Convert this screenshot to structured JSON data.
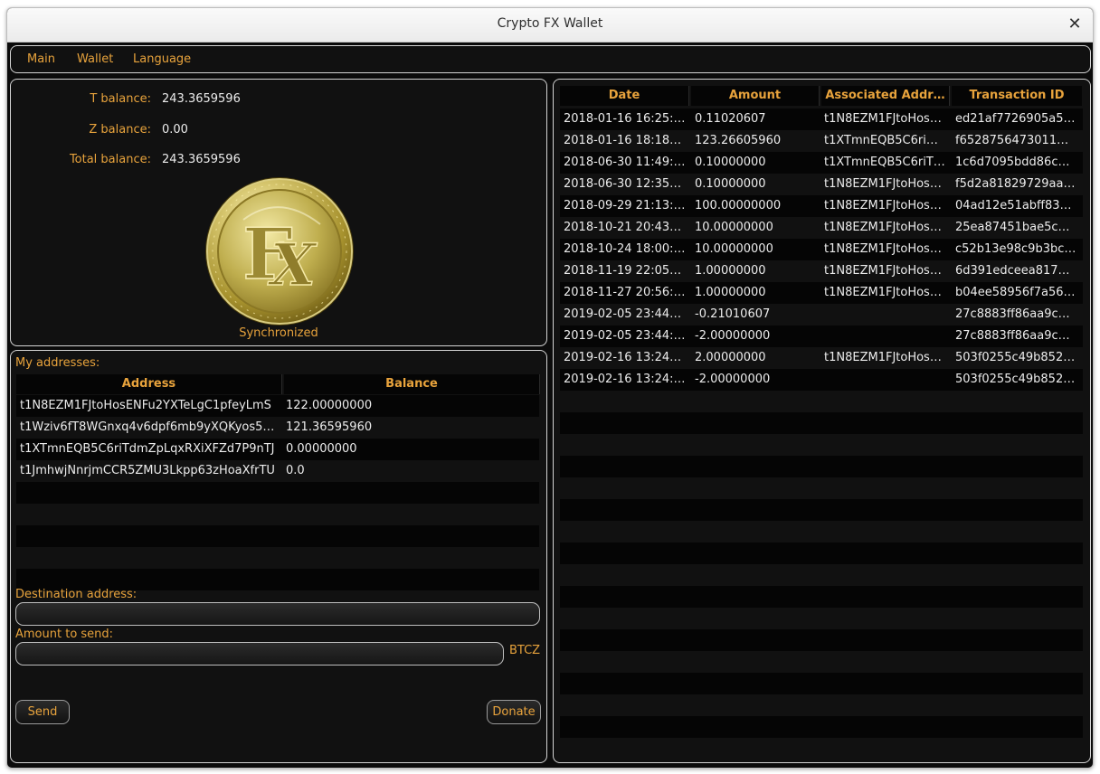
{
  "window": {
    "title": "Crypto FX Wallet"
  },
  "menu": {
    "items": [
      "Main",
      "Wallet",
      "Language"
    ]
  },
  "balances": {
    "t_label": "T balance:",
    "t_value": "243.3659596",
    "z_label": "Z balance:",
    "z_value": "0.00",
    "total_label": "Total balance:",
    "total_value": "243.3659596",
    "status": "Synchronized"
  },
  "addresses": {
    "title": "My addresses:",
    "columns": [
      "Address",
      "Balance"
    ],
    "rows": [
      {
        "address": "t1N8EZM1FJtoHosENFu2YXTeLgC1pfeyLmS",
        "balance": "122.00000000"
      },
      {
        "address": "t1Wziv6fT8WGnxq4v6dpf6mb9yXQKyos5…",
        "balance": "121.36595960"
      },
      {
        "address": "t1XTmnEQB5C6riTdmZpLqxRXiXFZd7P9nTJ",
        "balance": "0.00000000"
      },
      {
        "address": "t1JmhwjNnrjmCCR5ZMU3Lkpp63zHoaXfrTU",
        "balance": "0.0"
      }
    ]
  },
  "send": {
    "destination_label": "Destination address:",
    "destination_value": "",
    "amount_label": "Amount to send:",
    "amount_value": "",
    "currency": "BTCZ",
    "send_label": "Send",
    "donate_label": "Donate"
  },
  "transactions": {
    "columns": [
      "Date",
      "Amount",
      "Associated Addr…",
      "Transaction ID"
    ],
    "rows": [
      {
        "date": "2018-01-16 16:25:…",
        "amount": "0.11020607",
        "address": "t1N8EZM1FJtoHos…",
        "txid": "ed21af7726905a5…"
      },
      {
        "date": "2018-01-16 18:18…",
        "amount": "123.26605960",
        "address": "t1XTmnEQB5C6ri…",
        "txid": "f6528756473011…"
      },
      {
        "date": "2018-06-30 11:49:…",
        "amount": "0.10000000",
        "address": "t1XTmnEQB5C6riT…",
        "txid": "1c6d7095bdd86c…"
      },
      {
        "date": "2018-06-30 12:35…",
        "amount": "0.10000000",
        "address": "t1N8EZM1FJtoHos…",
        "txid": "f5d2a81829729aa…"
      },
      {
        "date": "2018-09-29 21:13:…",
        "amount": "100.00000000",
        "address": "t1N8EZM1FJtoHos…",
        "txid": "04ad12e51abff83…"
      },
      {
        "date": "2018-10-21 20:43…",
        "amount": "10.00000000",
        "address": "t1N8EZM1FJtoHos…",
        "txid": "25ea87451bae5c…"
      },
      {
        "date": "2018-10-24 18:00:…",
        "amount": "10.00000000",
        "address": "t1N8EZM1FJtoHos…",
        "txid": "c52b13e98c9b3bc…"
      },
      {
        "date": "2018-11-19 22:05…",
        "amount": "1.00000000",
        "address": "t1N8EZM1FJtoHos…",
        "txid": "6d391edceea817…"
      },
      {
        "date": "2018-11-27 20:56:…",
        "amount": "1.00000000",
        "address": "t1N8EZM1FJtoHos…",
        "txid": "b04ee58956f7a56…"
      },
      {
        "date": "2019-02-05 23:44…",
        "amount": "-0.21010607",
        "address": "",
        "txid": "27c8883ff86aa9c…"
      },
      {
        "date": "2019-02-05 23:44:…",
        "amount": "-2.00000000",
        "address": "",
        "txid": "27c8883ff86aa9c…"
      },
      {
        "date": "2019-02-16 13:24…",
        "amount": "2.00000000",
        "address": "t1N8EZM1FJtoHos…",
        "txid": "503f0255c49b852…"
      },
      {
        "date": "2019-02-16 13:24:…",
        "amount": "-2.00000000",
        "address": "",
        "txid": "503f0255c49b852…"
      }
    ]
  },
  "colors": {
    "accent": "#e8a33c",
    "background": "#0b0b0b",
    "text": "#ececec"
  },
  "icons": {
    "close": "close-icon",
    "coin": "fx-coin-logo"
  }
}
